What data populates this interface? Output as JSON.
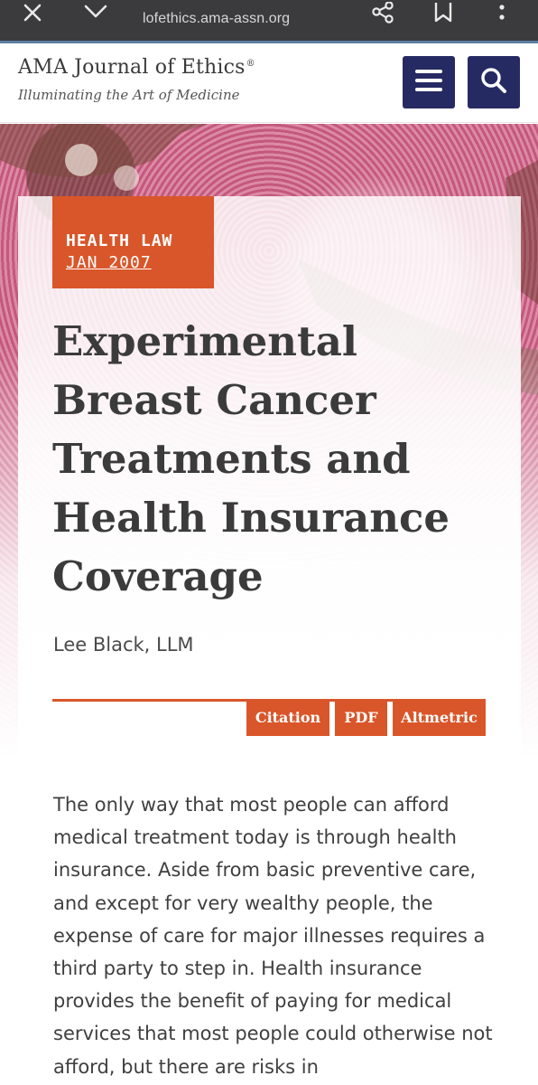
{
  "browser": {
    "url": "lofethics.ama-assn.org",
    "icons": [
      "close-icon",
      "chevron-down-icon",
      "share-icon",
      "bookmark-icon",
      "more-icon"
    ]
  },
  "site": {
    "title": "AMA Journal of Ethics",
    "registered_mark": "®",
    "tagline": "Illuminating the Art of Medicine",
    "menu_icon": "menu-icon",
    "search_icon": "search-icon",
    "brand_color": "#262a62"
  },
  "article": {
    "category": "HEALTH LAW",
    "date": "JAN 2007",
    "title": "Experimental Breast Cancer Treatments and Health Insurance Coverage",
    "author": "Lee Black, LLM",
    "accent_color": "#d9562a",
    "actions": {
      "citation": "Citation",
      "pdf": "PDF",
      "altmetric": "Altmetric"
    },
    "body": "The only way that most people can afford medical treatment today is through health insurance. Aside from basic preventive care, and except for very wealthy people, the expense of care for major illnesses requires a third party to step in. Health insurance provides the benefit of paying for medical services that most people could otherwise not afford, but there are risks in"
  }
}
